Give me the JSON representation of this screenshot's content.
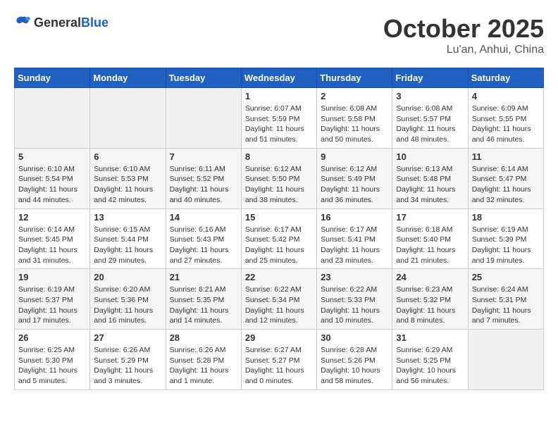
{
  "header": {
    "logo_general": "General",
    "logo_blue": "Blue",
    "month": "October 2025",
    "location": "Lu'an, Anhui, China"
  },
  "weekdays": [
    "Sunday",
    "Monday",
    "Tuesday",
    "Wednesday",
    "Thursday",
    "Friday",
    "Saturday"
  ],
  "weeks": [
    [
      {
        "day": "",
        "info": ""
      },
      {
        "day": "",
        "info": ""
      },
      {
        "day": "",
        "info": ""
      },
      {
        "day": "1",
        "info": "Sunrise: 6:07 AM\nSunset: 5:59 PM\nDaylight: 11 hours and 51 minutes."
      },
      {
        "day": "2",
        "info": "Sunrise: 6:08 AM\nSunset: 5:58 PM\nDaylight: 11 hours and 50 minutes."
      },
      {
        "day": "3",
        "info": "Sunrise: 6:08 AM\nSunset: 5:57 PM\nDaylight: 11 hours and 48 minutes."
      },
      {
        "day": "4",
        "info": "Sunrise: 6:09 AM\nSunset: 5:55 PM\nDaylight: 11 hours and 46 minutes."
      }
    ],
    [
      {
        "day": "5",
        "info": "Sunrise: 6:10 AM\nSunset: 5:54 PM\nDaylight: 11 hours and 44 minutes."
      },
      {
        "day": "6",
        "info": "Sunrise: 6:10 AM\nSunset: 5:53 PM\nDaylight: 11 hours and 42 minutes."
      },
      {
        "day": "7",
        "info": "Sunrise: 6:11 AM\nSunset: 5:52 PM\nDaylight: 11 hours and 40 minutes."
      },
      {
        "day": "8",
        "info": "Sunrise: 6:12 AM\nSunset: 5:50 PM\nDaylight: 11 hours and 38 minutes."
      },
      {
        "day": "9",
        "info": "Sunrise: 6:12 AM\nSunset: 5:49 PM\nDaylight: 11 hours and 36 minutes."
      },
      {
        "day": "10",
        "info": "Sunrise: 6:13 AM\nSunset: 5:48 PM\nDaylight: 11 hours and 34 minutes."
      },
      {
        "day": "11",
        "info": "Sunrise: 6:14 AM\nSunset: 5:47 PM\nDaylight: 11 hours and 32 minutes."
      }
    ],
    [
      {
        "day": "12",
        "info": "Sunrise: 6:14 AM\nSunset: 5:45 PM\nDaylight: 11 hours and 31 minutes."
      },
      {
        "day": "13",
        "info": "Sunrise: 6:15 AM\nSunset: 5:44 PM\nDaylight: 11 hours and 29 minutes."
      },
      {
        "day": "14",
        "info": "Sunrise: 6:16 AM\nSunset: 5:43 PM\nDaylight: 11 hours and 27 minutes."
      },
      {
        "day": "15",
        "info": "Sunrise: 6:17 AM\nSunset: 5:42 PM\nDaylight: 11 hours and 25 minutes."
      },
      {
        "day": "16",
        "info": "Sunrise: 6:17 AM\nSunset: 5:41 PM\nDaylight: 11 hours and 23 minutes."
      },
      {
        "day": "17",
        "info": "Sunrise: 6:18 AM\nSunset: 5:40 PM\nDaylight: 11 hours and 21 minutes."
      },
      {
        "day": "18",
        "info": "Sunrise: 6:19 AM\nSunset: 5:39 PM\nDaylight: 11 hours and 19 minutes."
      }
    ],
    [
      {
        "day": "19",
        "info": "Sunrise: 6:19 AM\nSunset: 5:37 PM\nDaylight: 11 hours and 17 minutes."
      },
      {
        "day": "20",
        "info": "Sunrise: 6:20 AM\nSunset: 5:36 PM\nDaylight: 11 hours and 16 minutes."
      },
      {
        "day": "21",
        "info": "Sunrise: 6:21 AM\nSunset: 5:35 PM\nDaylight: 11 hours and 14 minutes."
      },
      {
        "day": "22",
        "info": "Sunrise: 6:22 AM\nSunset: 5:34 PM\nDaylight: 11 hours and 12 minutes."
      },
      {
        "day": "23",
        "info": "Sunrise: 6:22 AM\nSunset: 5:33 PM\nDaylight: 11 hours and 10 minutes."
      },
      {
        "day": "24",
        "info": "Sunrise: 6:23 AM\nSunset: 5:32 PM\nDaylight: 11 hours and 8 minutes."
      },
      {
        "day": "25",
        "info": "Sunrise: 6:24 AM\nSunset: 5:31 PM\nDaylight: 11 hours and 7 minutes."
      }
    ],
    [
      {
        "day": "26",
        "info": "Sunrise: 6:25 AM\nSunset: 5:30 PM\nDaylight: 11 hours and 5 minutes."
      },
      {
        "day": "27",
        "info": "Sunrise: 6:26 AM\nSunset: 5:29 PM\nDaylight: 11 hours and 3 minutes."
      },
      {
        "day": "28",
        "info": "Sunrise: 6:26 AM\nSunset: 5:28 PM\nDaylight: 11 hours and 1 minute."
      },
      {
        "day": "29",
        "info": "Sunrise: 6:27 AM\nSunset: 5:27 PM\nDaylight: 11 hours and 0 minutes."
      },
      {
        "day": "30",
        "info": "Sunrise: 6:28 AM\nSunset: 5:26 PM\nDaylight: 10 hours and 58 minutes."
      },
      {
        "day": "31",
        "info": "Sunrise: 6:29 AM\nSunset: 5:25 PM\nDaylight: 10 hours and 56 minutes."
      },
      {
        "day": "",
        "info": ""
      }
    ]
  ]
}
